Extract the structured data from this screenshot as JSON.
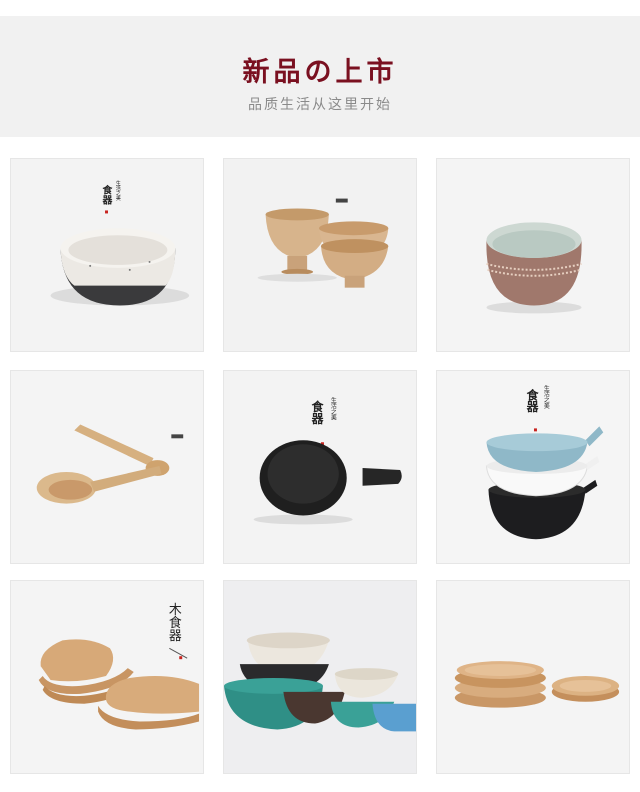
{
  "header": {
    "title": "新品の上市",
    "subtitle": "品质生活从这里开始"
  },
  "colors": {
    "title": "#7a1020",
    "header_bg": "#f1f1f1",
    "seal": "#c8231f"
  },
  "products": [
    {
      "id": "speckled-bowl",
      "caption_main": "食器",
      "caption_side": "生活之美"
    },
    {
      "id": "wooden-bowls",
      "caption_main": "",
      "caption_side": ""
    },
    {
      "id": "rust-cup",
      "caption_main": "",
      "caption_side": ""
    },
    {
      "id": "wooden-spoons",
      "caption_main": "",
      "caption_side": ""
    },
    {
      "id": "black-pan",
      "caption_main": "食器",
      "caption_side": "生活之美"
    },
    {
      "id": "stacked-bowls",
      "caption_main": "食器",
      "caption_side": "生活之美"
    },
    {
      "id": "wood-plates",
      "caption_main": "木食器",
      "caption_side": ""
    },
    {
      "id": "colored-bowls",
      "caption_main": "",
      "caption_side": ""
    },
    {
      "id": "round-wood-plates",
      "caption_main": "",
      "caption_side": ""
    }
  ]
}
